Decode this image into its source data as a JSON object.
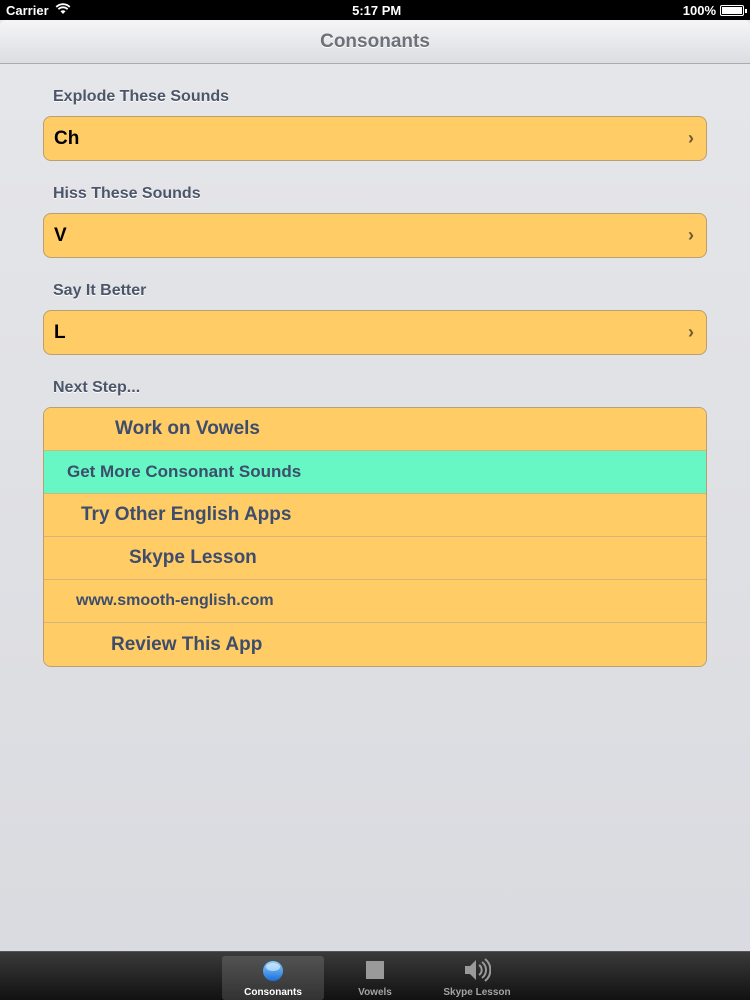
{
  "status_bar": {
    "carrier": "Carrier",
    "time": "5:17 PM",
    "battery": "100%"
  },
  "nav": {
    "title": "Consonants"
  },
  "sections": [
    {
      "header": "Explode These Sounds",
      "item": "Ch"
    },
    {
      "header": "Hiss These Sounds",
      "item": "V"
    },
    {
      "header": "Say It Better",
      "item": "L"
    }
  ],
  "next_step": {
    "header": "Next Step...",
    "items": [
      "Work on Vowels",
      "Get More Consonant Sounds",
      "Try Other English Apps",
      "Skype Lesson",
      "www.smooth-english.com",
      "Review This App"
    ]
  },
  "tabs": [
    "Consonants",
    "Vowels",
    "Skype Lesson"
  ],
  "colors": {
    "cell": "#ffcc66",
    "highlight": "#66f7c4",
    "label": "#3d4d6b"
  }
}
